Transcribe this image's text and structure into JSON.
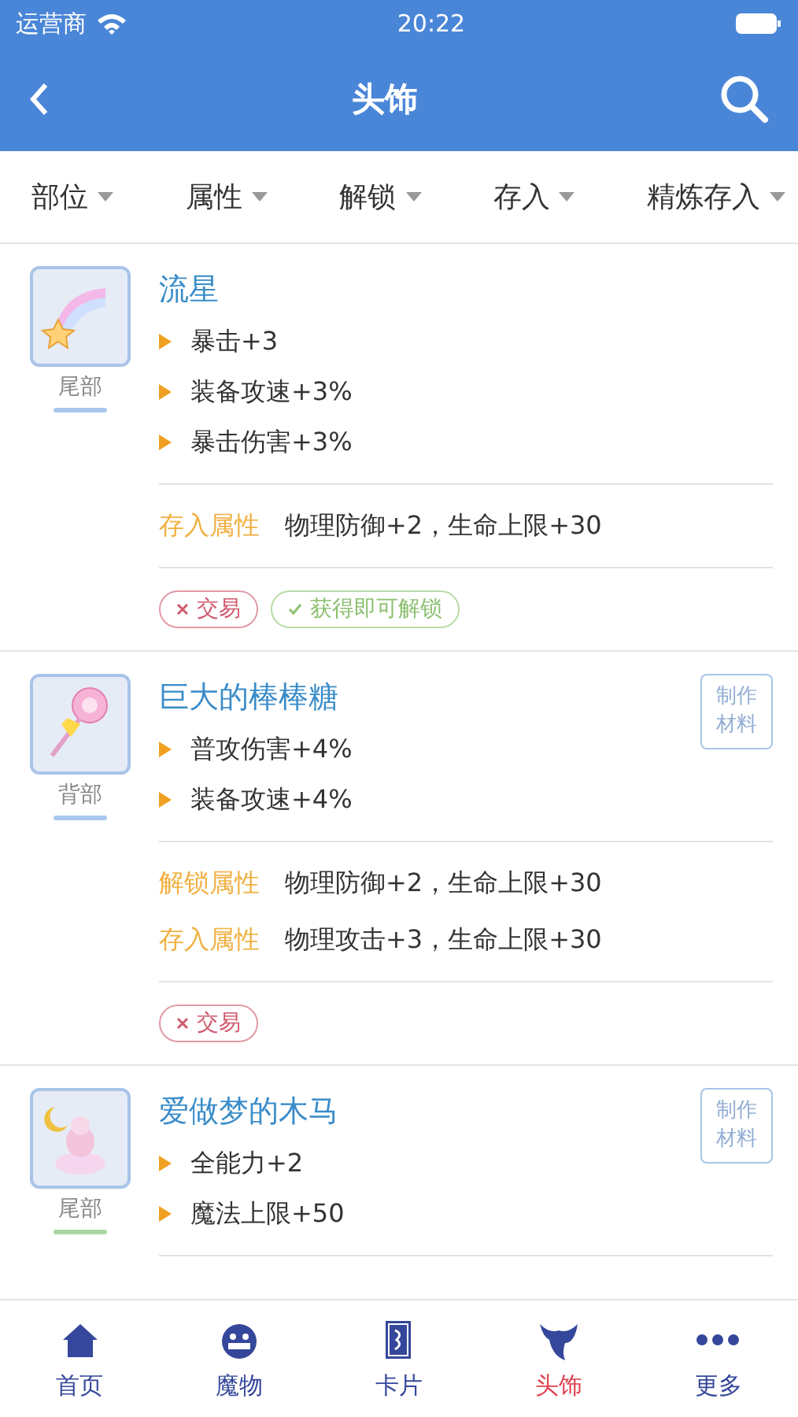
{
  "status_bar": {
    "carrier": "运营商",
    "time": "20:22"
  },
  "header": {
    "title": "头饰"
  },
  "filters": [
    {
      "label": "部位"
    },
    {
      "label": "属性"
    },
    {
      "label": "解锁"
    },
    {
      "label": "存入"
    },
    {
      "label": "精炼存入"
    }
  ],
  "items": [
    {
      "name": "流星",
      "slot": "尾部",
      "color": "#a9c8ee",
      "stats": [
        "暴击+3",
        "装备攻速+3%",
        "暴击伤害+3%"
      ],
      "attributes": [
        {
          "label": "存入属性",
          "value": "物理防御+2，生命上限+30"
        }
      ],
      "tags": [
        {
          "kind": "cross",
          "label": "交易"
        },
        {
          "kind": "check",
          "label": "获得即可解锁"
        }
      ]
    },
    {
      "name": "巨大的棒棒糖",
      "slot": "背部",
      "color": "#a9c8ee",
      "material_button": "制作材料",
      "stats": [
        "普攻伤害+4%",
        "装备攻速+4%"
      ],
      "attributes": [
        {
          "label": "解锁属性",
          "value": "物理防御+2，生命上限+30"
        },
        {
          "label": "存入属性",
          "value": "物理攻击+3，生命上限+30"
        }
      ],
      "tags": [
        {
          "kind": "cross",
          "label": "交易"
        }
      ]
    },
    {
      "name": "爱做梦的木马",
      "slot": "尾部",
      "color": "#a8d8a0",
      "material_button": "制作材料",
      "stats": [
        "全能力+2",
        "魔法上限+50"
      ]
    }
  ],
  "tab_bar": [
    {
      "label": "首页",
      "selected": false
    },
    {
      "label": "魔物",
      "selected": false
    },
    {
      "label": "卡片",
      "selected": false
    },
    {
      "label": "头饰",
      "selected": true
    },
    {
      "label": "更多",
      "selected": false
    }
  ]
}
